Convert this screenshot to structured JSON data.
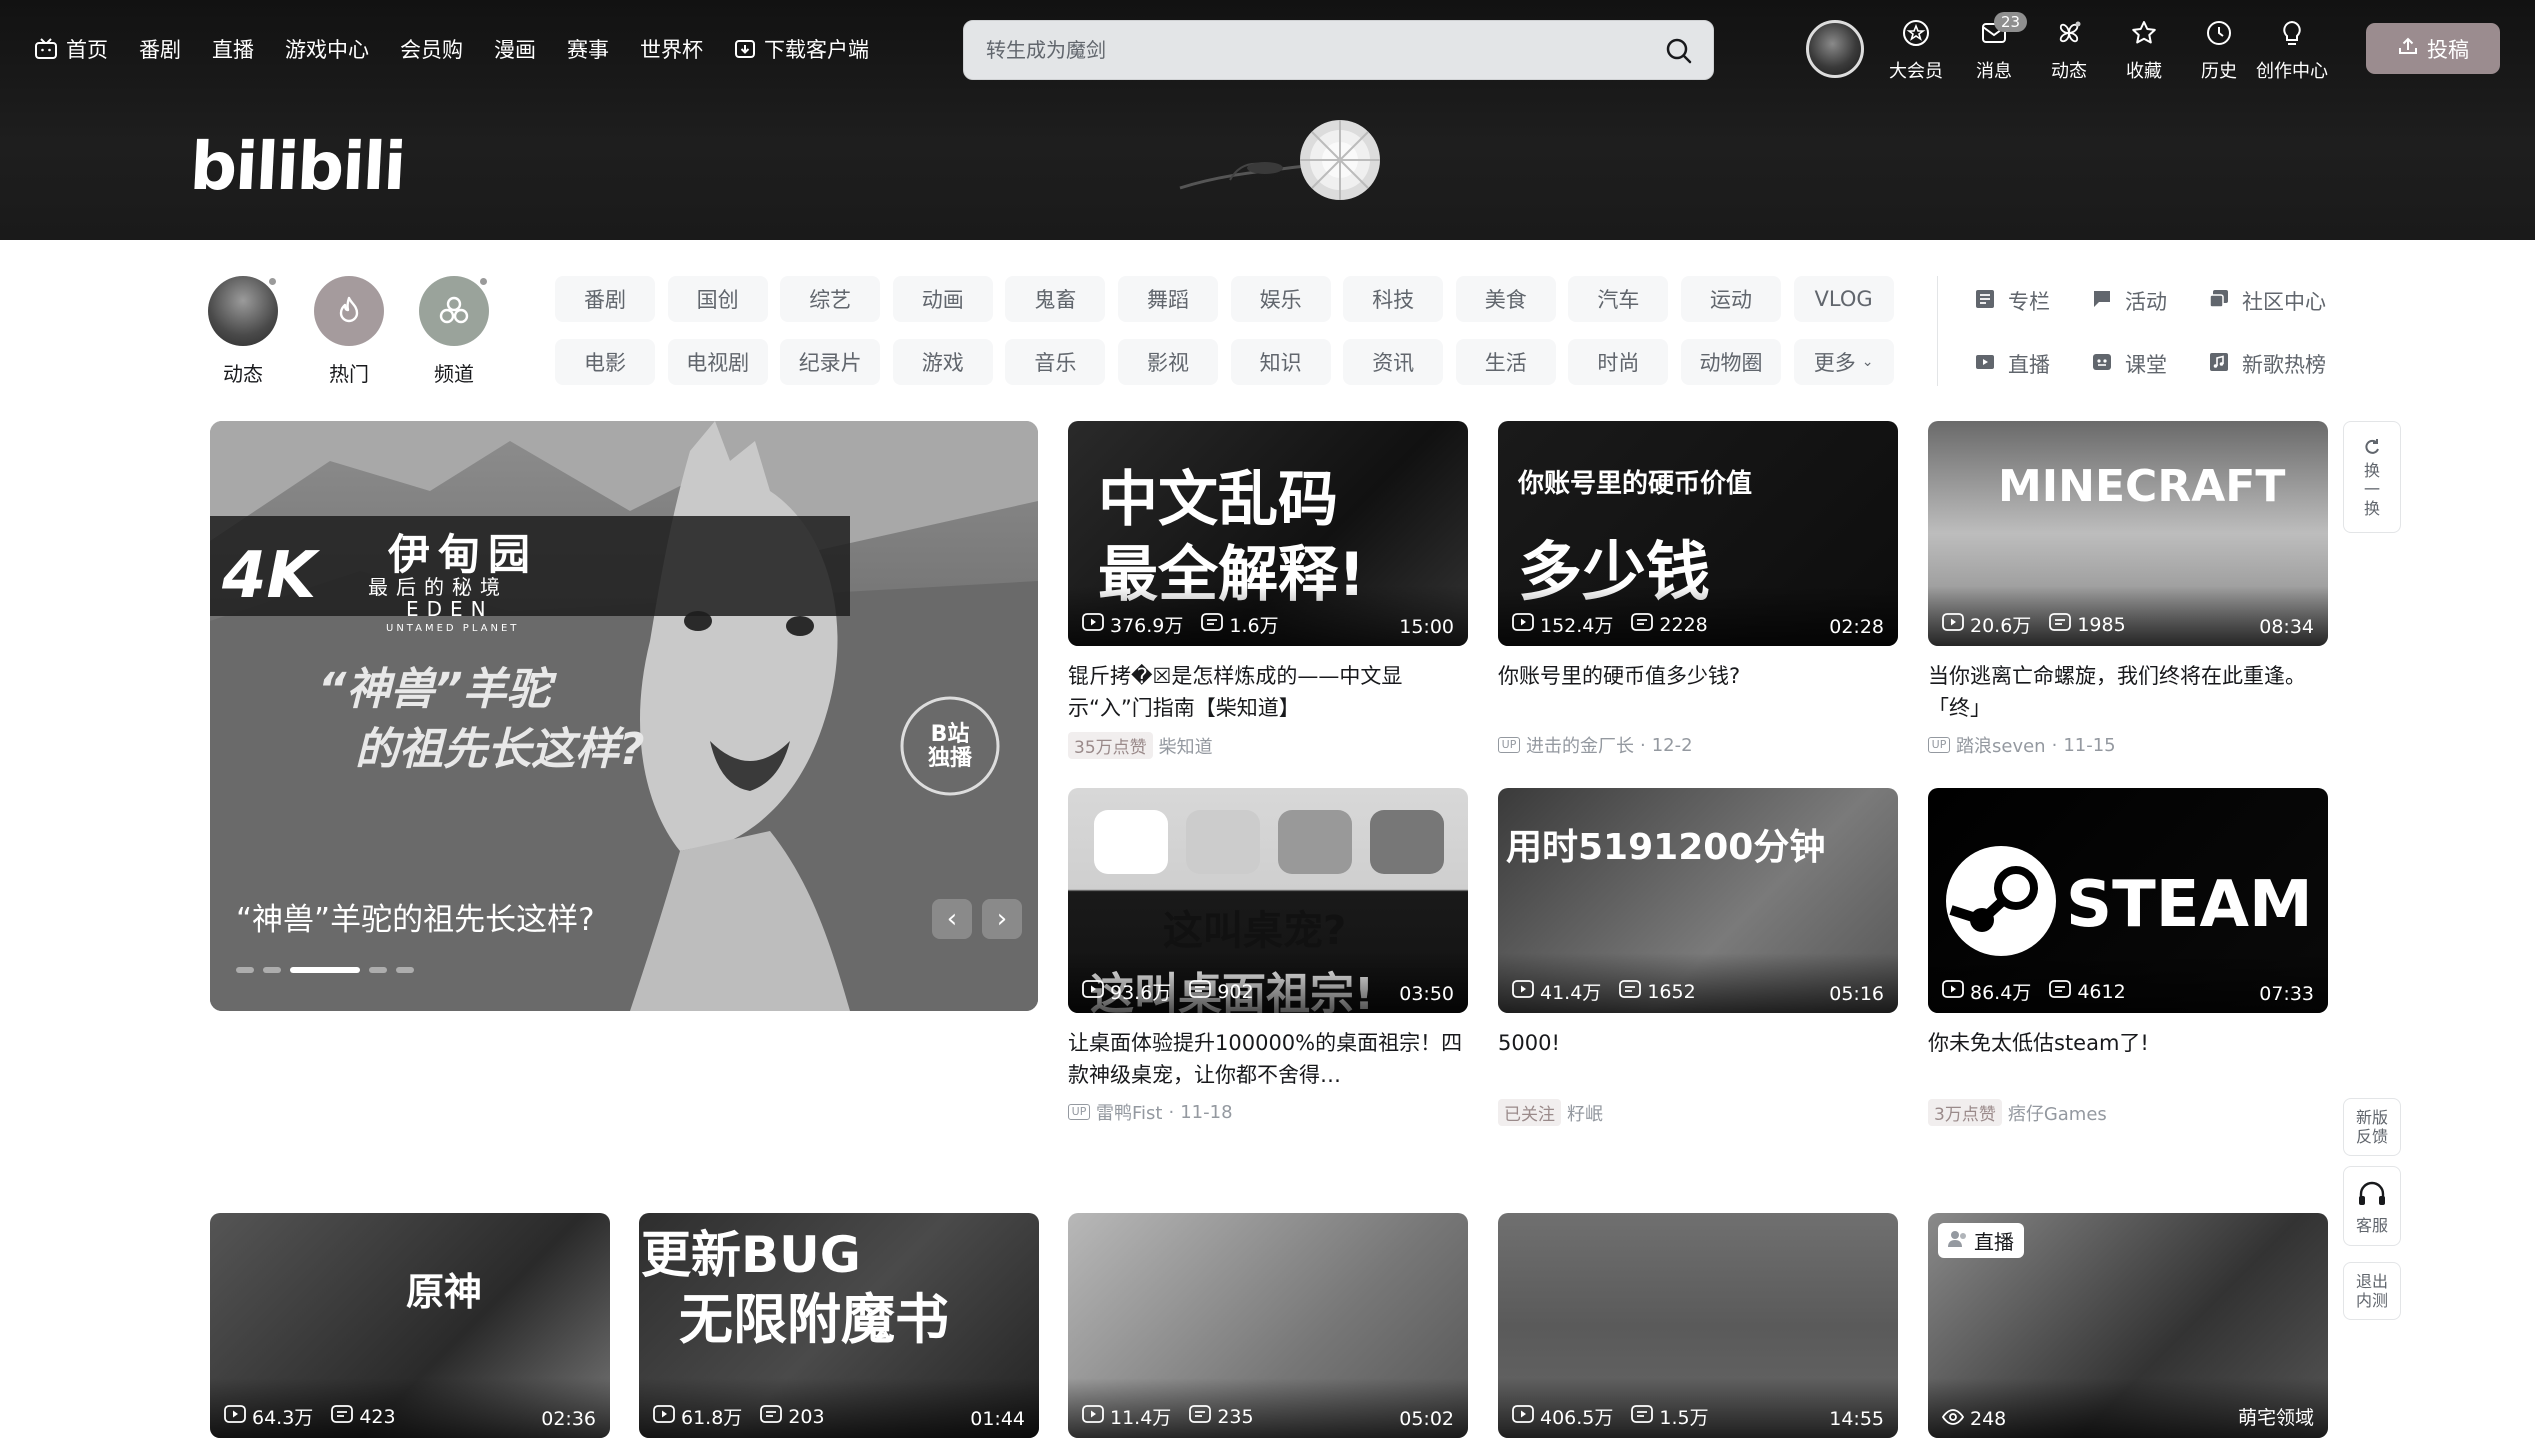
{
  "header": {
    "nav": [
      {
        "label": "首页",
        "icon": "tv-icon"
      },
      {
        "label": "番剧"
      },
      {
        "label": "直播"
      },
      {
        "label": "游戏中心"
      },
      {
        "label": "会员购"
      },
      {
        "label": "漫画"
      },
      {
        "label": "赛事"
      },
      {
        "label": "世界杯"
      },
      {
        "label": "下载客户端",
        "icon": "download-icon"
      }
    ],
    "search": {
      "placeholder": "转生成为魔剑"
    },
    "right": [
      {
        "label": "大会员",
        "icon": "vip-icon"
      },
      {
        "label": "消息",
        "icon": "message-icon",
        "badge": "23"
      },
      {
        "label": "动态",
        "icon": "dynamic-icon"
      },
      {
        "label": "收藏",
        "icon": "star-icon"
      },
      {
        "label": "历史",
        "icon": "clock-icon"
      },
      {
        "label": "创作中心",
        "icon": "bulb-icon"
      }
    ],
    "upload_label": "投稿",
    "logo_text": "bilibili"
  },
  "channels": {
    "circles": [
      {
        "label": "动态"
      },
      {
        "label": "热门"
      },
      {
        "label": "频道"
      }
    ],
    "row1": [
      "番剧",
      "国创",
      "综艺",
      "动画",
      "鬼畜",
      "舞蹈",
      "娱乐",
      "科技",
      "美食",
      "汽车",
      "运动",
      "VLOG"
    ],
    "row2": [
      "电影",
      "电视剧",
      "纪录片",
      "游戏",
      "音乐",
      "影视",
      "知识",
      "资讯",
      "生活",
      "时尚",
      "动物圈",
      "更多"
    ],
    "side": [
      {
        "label": "专栏",
        "icon": "article-icon"
      },
      {
        "label": "活动",
        "icon": "flag-icon"
      },
      {
        "label": "社区中心",
        "icon": "community-icon"
      },
      {
        "label": "直播",
        "icon": "live-icon"
      },
      {
        "label": "课堂",
        "icon": "classroom-icon"
      },
      {
        "label": "新歌热榜",
        "icon": "music-chart-icon"
      }
    ]
  },
  "carousel": {
    "title": "“神兽”羊驼的祖先长这样?",
    "active_index": 2,
    "slides": 5,
    "overlay_texts": {
      "badge": "4K",
      "series": "伊甸园",
      "series_sub": "最后的秘境",
      "eden": "EDEN",
      "untamed": "UNTAMED PLANET",
      "line1": "“神兽”羊驼",
      "line2": "的祖先长这样?",
      "stamp": "B站独播"
    }
  },
  "videos": [
    {
      "title": "锟斤拷�☒是怎样炼成的——中文显示“⼊”门指南【柴知道】",
      "views": "376.9万",
      "danmaku": "1.6万",
      "duration": "15:00",
      "tag": "35万点赞",
      "author": "柴知道",
      "date": "",
      "thumb_text": [
        "中文乱码",
        "最全解释!"
      ]
    },
    {
      "title": "你账号里的硬币值多少钱?",
      "views": "152.4万",
      "danmaku": "2228",
      "duration": "02:28",
      "tag": "",
      "author": "进击的金厂长",
      "date": "12-2",
      "thumb_text": [
        "你账号里的硬币价值",
        "多少钱"
      ]
    },
    {
      "title": "当你逃离亡命螺旋，我们终将在此重逢。「终」",
      "views": "20.6万",
      "danmaku": "1985",
      "duration": "08:34",
      "tag": "",
      "author": "踏浪seven",
      "date": "11-15",
      "thumb_text": [
        "MINECRAFT"
      ]
    },
    {
      "title": "让桌面体验提升100000%的桌面祖宗！四款神级桌宠，让你都不舍得…",
      "views": "93.6万",
      "danmaku": "902",
      "duration": "03:50",
      "tag": "",
      "author": "雷鸭Fist",
      "date": "11-18",
      "thumb_text": [
        "这叫桌宠?",
        "这叫桌面祖宗!"
      ]
    },
    {
      "title": "5000!",
      "views": "41.4万",
      "danmaku": "1652",
      "duration": "05:16",
      "tag": "已关注",
      "author": "籽岷",
      "date": "",
      "thumb_text": [
        "用时5191200分钟"
      ]
    },
    {
      "title": "你未免太低估steam了!",
      "views": "86.4万",
      "danmaku": "4612",
      "duration": "07:33",
      "tag": "3万点赞",
      "author": "痞仔Games",
      "date": "",
      "thumb_text": [
        "STEAM"
      ]
    },
    {
      "views": "64.3万",
      "danmaku": "423",
      "duration": "02:36",
      "thumb_text": [
        "原神"
      ]
    },
    {
      "views": "61.8万",
      "danmaku": "203",
      "duration": "01:44",
      "thumb_text": [
        "更新BUG",
        "无限附魔书"
      ]
    },
    {
      "views": "11.4万",
      "danmaku": "235",
      "duration": "05:02"
    },
    {
      "views": "406.5万",
      "danmaku": "1.5万",
      "duration": "14:55"
    },
    {
      "views": "248",
      "live_badge": "直播",
      "area": "萌宅领域"
    }
  ],
  "floating": {
    "refresh": "换一换",
    "feedback": "新版反馈",
    "service": "客服",
    "exit": "退出内测"
  }
}
